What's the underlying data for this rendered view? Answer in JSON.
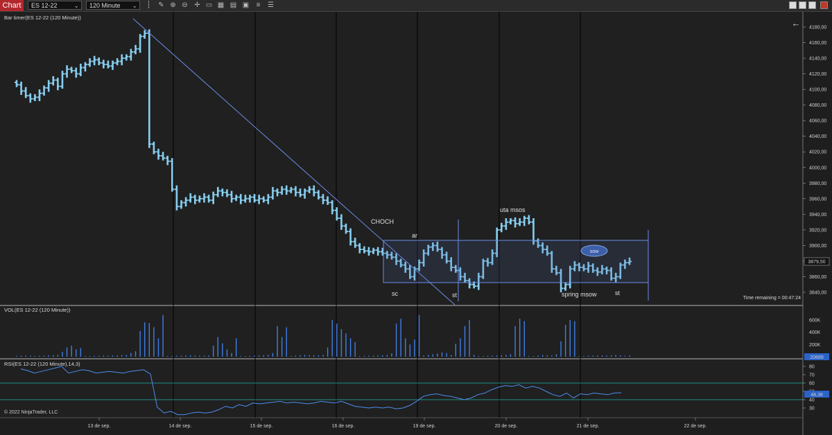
{
  "toolbar": {
    "tab_label": "Chart",
    "instrument": "ES 12-22",
    "interval": "120 Minute",
    "icons": [
      "bar-style-icon",
      "draw-pencil-icon",
      "zoom-in-icon",
      "zoom-out-icon",
      "crosshair-icon",
      "indicators-icon",
      "strategies-icon",
      "templates-icon",
      "data-box-icon",
      "properties-icon"
    ]
  },
  "price_panel": {
    "title": "Bar timer(ES 12-22 (120 Minute))",
    "y_ticks": [
      "4180,00",
      "4160,00",
      "4140,00",
      "4120,00",
      "4100,00",
      "4080,00",
      "4060,00",
      "4040,00",
      "4020,00",
      "4000,00",
      "3980,00",
      "3960,00",
      "3940,00",
      "3920,00",
      "3900,00",
      "3880,00",
      "3860,00",
      "3840,00"
    ],
    "last_price": "3879,50",
    "time_remaining": "Time remaining = 00:47:24",
    "annotations": [
      "CHOCH",
      "ar",
      "sc",
      "st",
      "uta msos",
      "spring msow",
      "st",
      "sow"
    ]
  },
  "volume_panel": {
    "title": "VOL(ES 12-22 (120 Minute))",
    "y_ticks": [
      "600K",
      "400K",
      "200K"
    ],
    "last_value": "20889"
  },
  "rsi_panel": {
    "title": "RSI(ES 12-22 (120 Minute),14,3)",
    "y_ticks": [
      "80",
      "70",
      "60",
      "50",
      "40",
      "30"
    ],
    "last_value": "48,38"
  },
  "copyright": "© 2022 NinjaTrader, LLC",
  "x_ticks": [
    "13 de sep.",
    "14 de sep.",
    "15 de sep.",
    "16 de sep.",
    "19 de sep.",
    "20 de sep.",
    "21 de sep.",
    "22 de sep."
  ],
  "colors": {
    "bar": "#87cef0",
    "accent_red": "#b3282d",
    "line_blue": "#6c8ee8",
    "volume": "#3f7fe8",
    "rsi": "#4d8ef0",
    "level": "#1f8f86"
  },
  "chart_data": {
    "type": "ohlc-bar",
    "bars_close": [
      4106,
      4098,
      4092,
      4088,
      4090,
      4095,
      4102,
      4108,
      4112,
      4104,
      4120,
      4126,
      4124,
      4120,
      4128,
      4132,
      4136,
      4138,
      4134,
      4132,
      4130,
      4134,
      4136,
      4140,
      4142,
      4148,
      4152,
      4168,
      4172,
      4030,
      4020,
      4015,
      4012,
      4008,
      3972,
      3950,
      3955,
      3958,
      3962,
      3958,
      3960,
      3962,
      3958,
      3965,
      3970,
      3968,
      3965,
      3960,
      3962,
      3958,
      3960,
      3962,
      3958,
      3960,
      3958,
      3962,
      3970,
      3968,
      3972,
      3970,
      3972,
      3968,
      3965,
      3970,
      3972,
      3968,
      3962,
      3958,
      3955,
      3945,
      3935,
      3925,
      3918,
      3905,
      3900,
      3895,
      3893,
      3892,
      3894,
      3892,
      3890,
      3888,
      3885,
      3880,
      3875,
      3870,
      3860,
      3870,
      3878,
      3890,
      3898,
      3900,
      3895,
      3888,
      3880,
      3872,
      3868,
      3860,
      3855,
      3850,
      3848,
      3860,
      3880,
      3878,
      3890,
      3920,
      3925,
      3930,
      3932,
      3928,
      3930,
      3935,
      3930,
      3906,
      3900,
      3895,
      3890,
      3870,
      3865,
      3845,
      3850,
      3870,
      3875,
      3872,
      3870,
      3874,
      3868,
      3866,
      3870,
      3868,
      3858,
      3860,
      3875,
      3878,
      3879.5
    ],
    "volume_k": [
      12,
      18,
      20,
      16,
      14,
      15,
      18,
      22,
      25,
      30,
      80,
      150,
      180,
      120,
      140,
      10,
      12,
      14,
      15,
      18,
      16,
      20,
      22,
      25,
      30,
      60,
      90,
      420,
      560,
      550,
      480,
      300,
      680,
      10,
      12,
      15,
      18,
      20,
      25,
      22,
      18,
      15,
      20,
      180,
      320,
      220,
      120,
      60,
      300,
      10,
      12,
      15,
      18,
      20,
      25,
      30,
      60,
      500,
      320,
      480,
      10,
      20,
      25,
      30,
      28,
      25,
      22,
      30,
      150,
      600,
      540,
      450,
      380,
      300,
      240,
      10,
      12,
      15,
      18,
      20,
      25,
      30,
      55,
      540,
      620,
      300,
      200,
      280,
      680,
      20,
      30,
      40,
      50,
      70,
      60,
      30,
      210,
      300,
      500,
      600,
      30,
      10,
      12,
      15,
      18,
      20,
      25,
      30,
      40,
      500,
      620,
      580,
      10,
      12,
      20,
      30,
      25,
      20,
      40,
      250,
      520,
      600,
      580,
      10,
      12,
      15,
      18,
      20,
      20,
      18,
      25,
      30,
      20,
      15,
      20.889
    ],
    "rsi": [
      77,
      75,
      72,
      74,
      76,
      78,
      80,
      72,
      74,
      76,
      75,
      72,
      73,
      74,
      73,
      72,
      74,
      75,
      76,
      71,
      31,
      24,
      26,
      22,
      22,
      24,
      25,
      24,
      25,
      28,
      32,
      30,
      34,
      32,
      36,
      35,
      36,
      37,
      38,
      36,
      37,
      36,
      35,
      36,
      38,
      37,
      36,
      38,
      35,
      32,
      31,
      30,
      31,
      30,
      31,
      29,
      30,
      33,
      38,
      44,
      46,
      47,
      45,
      44,
      42,
      40,
      42,
      46,
      48,
      52,
      55,
      57,
      56,
      58,
      54,
      56,
      54,
      50,
      46,
      44,
      48,
      42,
      47,
      46,
      48,
      47,
      46,
      48,
      48.38
    ],
    "x_ticks": [
      "13 de sep.",
      "14 de sep.",
      "15 de sep.",
      "16 de sep.",
      "19 de sep.",
      "20 de sep.",
      "21 de sep.",
      "22 de sep."
    ],
    "ylim": [
      3830,
      4190
    ],
    "rsi_levels": [
      60,
      40
    ]
  }
}
